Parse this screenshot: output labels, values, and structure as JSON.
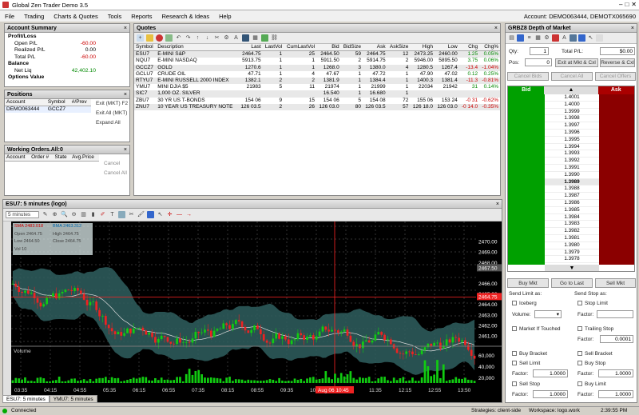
{
  "window": {
    "title": "Global Zen Trader Demo 3.5"
  },
  "menu": {
    "items": [
      "File",
      "Trading",
      "Charts & Quotes",
      "Tools",
      "Reports",
      "Research & Ideas",
      "Help"
    ],
    "account": "Account: DEMO063444, DEMOTX065690"
  },
  "account_summary": {
    "title": "Account Summary",
    "pl_header": "Profit/Loss",
    "open_label": "Open P/L",
    "open_value": "-60.00",
    "realized_label": "Realized P/L",
    "realized_value": "0.00",
    "total_label": "Total P/L",
    "total_value": "-60.00",
    "balance_header": "Balance",
    "netliq_label": "Net Liq",
    "netliq_value": "42,402.10",
    "options_label": "Options Value"
  },
  "positions": {
    "title": "Positions",
    "headers": [
      "Account",
      "Symbol",
      "#/Prev"
    ],
    "account": "DEMO063444",
    "symbol": "GCCZ7",
    "exit_label": "Exit (MKT) F2",
    "exit_all_label": "Exit All (MKT)",
    "expand_all_label": "Expand All"
  },
  "working_orders": {
    "title": "Working Orders.All:0",
    "headers": [
      "Account",
      "Order #",
      "State",
      "Avg.Price"
    ],
    "cancel_label": "Cancel",
    "cancel_all_label": "Cancel All"
  },
  "quotes": {
    "title": "Quotes",
    "headers": [
      "Symbol",
      "Description",
      "Last",
      "LastVol",
      "CumLastVol",
      "Bid",
      "BidSize",
      "Ask",
      "AskSize",
      "High",
      "Low",
      "Chg",
      "Chg%"
    ],
    "rows": [
      [
        "ESU7",
        "E-MINI S&P",
        "2464.75",
        "1",
        "25",
        "2464.50",
        "59",
        "2464.75",
        "12",
        "2473.25",
        "2460.00",
        "1.25",
        "0.05%"
      ],
      [
        "NQU7",
        "E-MINI NASDAQ",
        "5913.75",
        "1",
        "1",
        "5911.50",
        "2",
        "5914.75",
        "2",
        "5946.00",
        "5895.50",
        "3.75",
        "0.06%"
      ],
      [
        "GCCZ7",
        "GOLD",
        "1270.6",
        "1",
        "1",
        "1268.0",
        "3",
        "1380.0",
        "4",
        "1280.5",
        "1267.4",
        "-13.4",
        "-1.04%"
      ],
      [
        "GCLU7",
        "CRUDE OIL",
        "47.71",
        "1",
        "4",
        "47.67",
        "1",
        "47.72",
        "1",
        "47.90",
        "47.02",
        "0.12",
        "0.25%"
      ],
      [
        "RTYU7",
        "E-MINI RUSSELL 2000 INDEX",
        "1382.1",
        "2",
        "2",
        "1381.9",
        "1",
        "1384.4",
        "1",
        "1400.3",
        "1381.4",
        "-11.3",
        "-0.81%"
      ],
      [
        "YMU7",
        "MINI DJIA $5",
        "21983",
        "5",
        "11",
        "21974",
        "1",
        "21999",
        "1",
        "22034",
        "21942",
        "31",
        "0.14%"
      ],
      [
        "SIC7",
        "1,000 OZ. SILVER",
        "",
        "",
        "",
        "16.540",
        "1",
        "16.680",
        "1",
        "",
        "",
        "",
        ""
      ],
      [
        "ZBU7",
        "30 YR US T-BONDS",
        "154 06",
        "9",
        "15",
        "154 06",
        "5",
        "154 08",
        "72",
        "155 06",
        "153 24",
        "-0 31",
        "-0.62%"
      ],
      [
        "ZNU7",
        "10 YEAR US TREASURY NOTE",
        "126 03.5",
        "2",
        "26",
        "126 03.0",
        "80",
        "126 03.5",
        "57",
        "126 18.0",
        "126 03.0",
        "-0 14.0",
        "-0.35%"
      ]
    ]
  },
  "chart": {
    "title": "ESU7: 5 minutes (logo)",
    "interval": "5 minutes",
    "legend": [
      [
        "SMA",
        "2483.018"
      ],
      [
        "BMA",
        "2463.312"
      ],
      [
        "Open",
        "2464.75"
      ],
      [
        "High",
        "2464.75"
      ],
      [
        "Low",
        "2464.50"
      ],
      [
        "Close",
        "2464.75"
      ],
      [
        "Vol",
        "10"
      ]
    ],
    "y_labels": [
      "2470.00",
      "2469.00",
      "2468.00",
      "2467.50",
      "2466.00",
      "2465.00",
      "2464.75",
      "2464.00",
      "2463.00",
      "2462.00",
      "2461.00"
    ],
    "volume_label": "Volume",
    "vol_labels": [
      "60,000",
      "40,000",
      "20,000"
    ],
    "x_labels": [
      "03:35",
      "04:15",
      "04:55",
      "05:35",
      "06:15",
      "06:55",
      "07:35",
      "08:15",
      "08:55",
      "09:35",
      "10:15",
      "10:55",
      "11:35",
      "12:15",
      "12:55",
      "13:50"
    ],
    "crosshair_label": "Aug 06 10:45",
    "tabs": [
      "ESU7: 5 minutes",
      "YMU7: 5 minutes"
    ]
  },
  "dom": {
    "title": "GRBZ8  Depth of Market",
    "qty_label": "Qty:",
    "qty_value": "1",
    "total_pl_label": "Total P/L:",
    "total_pl_value": "$0.00",
    "pos_label": "Pos:",
    "pos_value": "0",
    "exit_btn": "Exit at Mkt & Cxl",
    "reverse_btn": "Reverse & Cxl",
    "cancel_bids": "Cancel Bids",
    "cancel_all": "Cancel All",
    "cancel_offers": "Cancel Offers",
    "bid_header": "Bid",
    "ask_header": "Ask",
    "prices": [
      "1.4001",
      "1.4000",
      "1.3999",
      "1.3998",
      "1.3997",
      "1.3996",
      "1.3995",
      "1.3994",
      "1.3993",
      "1.3992",
      "1.3991",
      "1.3990",
      "1.3989",
      "1.3988",
      "1.3987",
      "1.3986",
      "1.3985",
      "1.3984",
      "1.3983",
      "1.3982",
      "1.3981",
      "1.3980",
      "1.3979",
      "1.3978"
    ],
    "current": "1.3989",
    "buy_mkt": "Buy Mkt",
    "go_last": "Go to Last",
    "sell_mkt": "Sell Mkt",
    "send_limit": "Send Limit as:",
    "send_stop": "Send Stop as:",
    "iceberg": "Iceberg",
    "stop_limit": "Stop Limit",
    "volume_label": "Volume:",
    "factor_label": "Factor:",
    "market_touched": "Market If Touched",
    "trailing_stop": "Trailing Stop",
    "trailing_value": "0.0001",
    "buy_bracket": "Buy Bracket",
    "sell_bracket": "Sell Bracket",
    "sell_limit": "Sell Limit",
    "buy_stop": "Buy Stop",
    "factor_value": "1.0000",
    "sell_stop": "Sell Stop",
    "buy_limit": "Buy Limit"
  },
  "status": {
    "connected": "Connected",
    "strategies": "Strategies: client-side",
    "workspace": "Workspace: logo.work",
    "time": "2:39:55 PM"
  }
}
